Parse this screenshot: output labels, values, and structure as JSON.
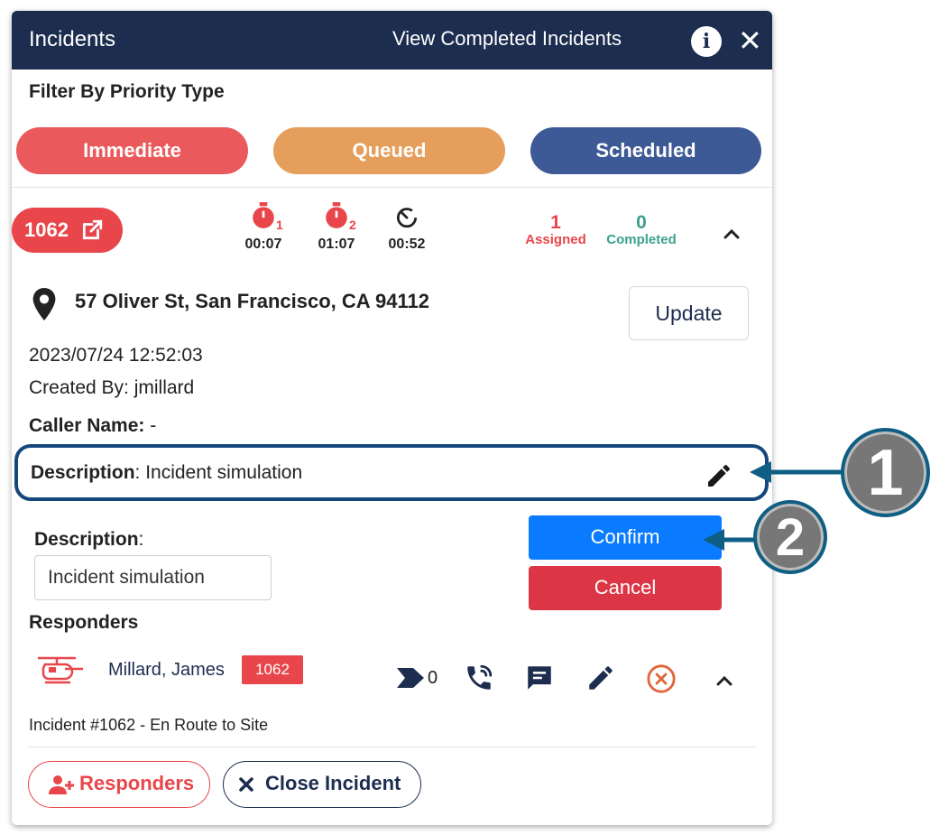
{
  "header": {
    "title": "Incidents",
    "view_completed": "View Completed Incidents",
    "info_icon": "info-icon",
    "close_icon": "close-icon"
  },
  "filter": {
    "label": "Filter By Priority Type",
    "priorities": [
      "Immediate",
      "Queued",
      "Scheduled"
    ],
    "colors": {
      "immediate": "#ea5a5c",
      "queued": "#e59e5b",
      "scheduled": "#3e5a96"
    }
  },
  "incident": {
    "number": "1062",
    "timers": [
      {
        "index": "1",
        "time": "00:07",
        "icon": "stopwatch-icon"
      },
      {
        "index": "2",
        "time": "01:07",
        "icon": "stopwatch-icon"
      },
      {
        "index": "",
        "time": "00:52",
        "icon": "timer-icon"
      }
    ],
    "assigned_count": "1",
    "assigned_label": "Assigned",
    "completed_count": "0",
    "completed_label": "Completed",
    "address": "57 Oliver St, San Francisco, CA 94112",
    "update_label": "Update",
    "datetime": "2023/07/24 12:52:03",
    "created_by": "Created By: jmillard",
    "caller_label": "Caller Name:",
    "caller_value": " -",
    "description_label": "Description",
    "description_value": ": Incident simulation"
  },
  "edit": {
    "label": "Description",
    "colon": ":",
    "input_value": "Incident simulation",
    "confirm_label": "Confirm",
    "cancel_label": "Cancel"
  },
  "responders": {
    "heading": "Responders",
    "items": [
      {
        "name": "Millard, James",
        "badge": "1062",
        "waypoint_count": "0",
        "status": "Incident #1062 - En Route to Site"
      }
    ]
  },
  "footer": {
    "responders_label": "Responders",
    "close_label": "Close Incident"
  },
  "callouts": [
    "1",
    "2"
  ]
}
